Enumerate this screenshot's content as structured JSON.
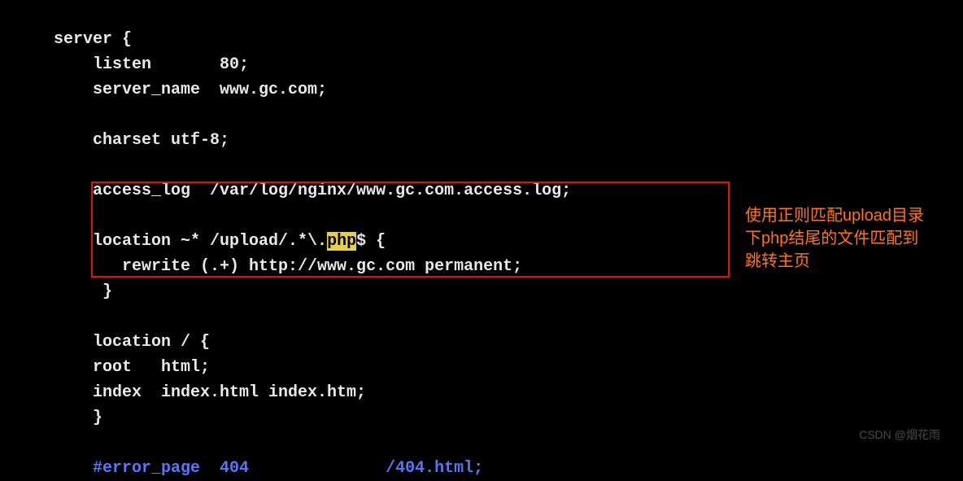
{
  "code": {
    "line1": "server {",
    "line2_a": "    listen       80;",
    "line3_a": "    server_name  www.gc.com;",
    "line4": "",
    "line5_a": "    charset utf-8;",
    "line6": "",
    "line7_a": "    access_log  /var/log/nginx/www.gc.com.access.log;",
    "line8": "",
    "line9_a": "    location ~* /upload/.*\\.",
    "line9_hl": "php",
    "line9_b": "$ {",
    "line10_a": "       rewrite (.+) http://www.gc.com permanent;",
    "line11_a": "     }",
    "line12": "",
    "line13_a": "    location / {",
    "line14_a": "    root   html;",
    "line15_a": "    index  index.html index.htm;",
    "line16_a": "    }",
    "line17": "",
    "line18_a": "    #error_page  404              /404.html;"
  },
  "annotation": {
    "line1": "使用正则匹配upload目录",
    "line2": "下php结尾的文件匹配到",
    "line3": "跳转主页"
  },
  "watermark": "CSDN @烟花雨"
}
